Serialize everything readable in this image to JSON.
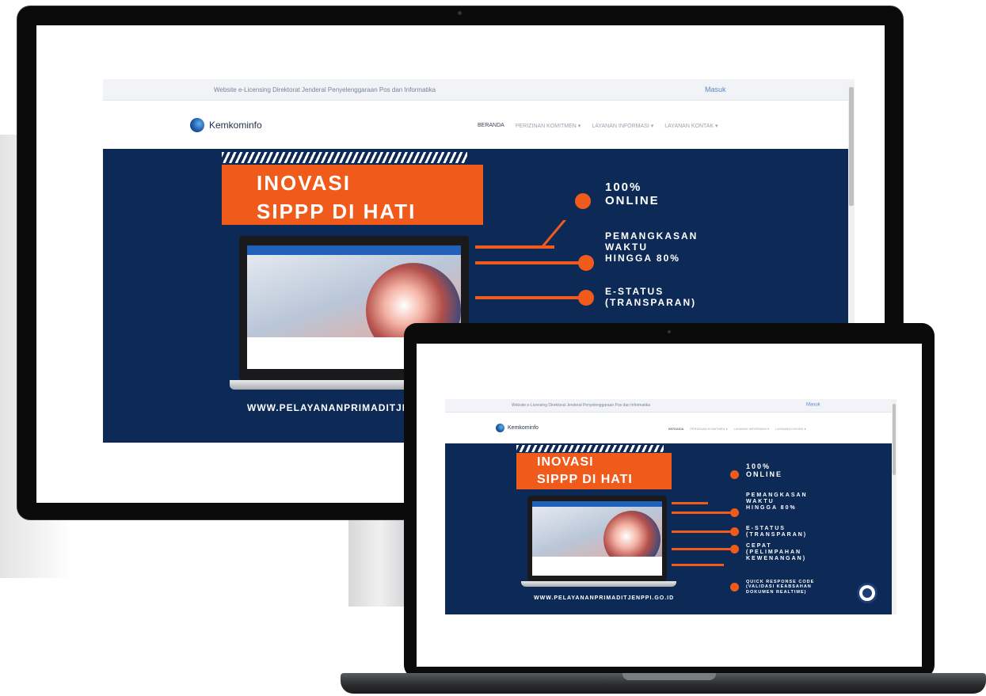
{
  "site": {
    "topbar_text": "Website e-Licensing Direktorat Jenderal Penyelenggaraan Pos dan Informatika",
    "login_label": "Masuk",
    "logo_text": "Kemkominfo",
    "menu": [
      "BERANDA",
      "PERIZINAN KOMITMEN ▾",
      "LAYANAN INFORMASI ▾",
      "LAYANAN KONTAK ▾"
    ]
  },
  "banner": {
    "title_line1": "INOVASI",
    "title_line2": "SIPPP DI HATI",
    "features": [
      "100%\nONLINE",
      "PEMANGKASAN\nWAKTU\nHINGGA 80%",
      "E-STATUS\n(TRANSPARAN)",
      "CEPAT\n(PELIMPAHAN\nKEWENANGAN)",
      "QUICK RESPONSE CODE\n(VALIDASI KEABSAHAN\nDOKUMEN REALTIME)"
    ],
    "url": "WWW.PELAYANANPRIMADITJENPPI.GO.ID",
    "url_monitor": "WWW.PELAYANANPRIMADITJEN"
  },
  "colors": {
    "banner_bg": "#0d2a57",
    "accent": "#f05a1a",
    "device": "#0b0b0c"
  }
}
